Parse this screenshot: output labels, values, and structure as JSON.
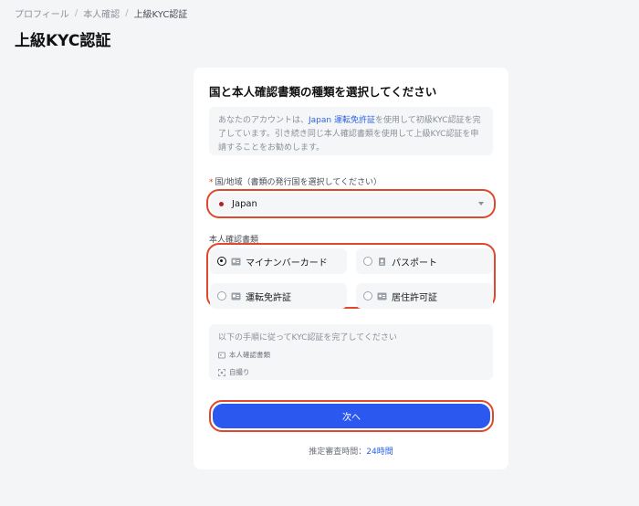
{
  "breadcrumb": {
    "items": [
      "プロフィール",
      "本人確認",
      "上級KYC認証"
    ],
    "separator": "/"
  },
  "page_title": "上級KYC認証",
  "card": {
    "title": "国と本人確認書類の種類を選択してください",
    "info": {
      "prefix": "あなたのアカウントは、",
      "link": "Japan 運転免許証",
      "suffix": "を使用して初級KYC認証を完了しています。引き続き同じ本人確認書類を使用して上級KYC認証を申請することをお勧めします。"
    },
    "country_field": {
      "required_mark": "*",
      "label": "国/地域（書類の発行国を選択してください）",
      "value": "Japan"
    },
    "doc_type": {
      "label": "本人確認書類",
      "options": [
        {
          "label": "マイナンバーカード",
          "selected": true
        },
        {
          "label": "パスポート",
          "selected": false
        },
        {
          "label": "運転免許証",
          "selected": false
        },
        {
          "label": "居住許可証",
          "selected": false
        }
      ]
    },
    "steps": {
      "intro": "以下の手順に従ってKYC認証を完了してください",
      "items": [
        "本人確認書類",
        "自撮り"
      ]
    },
    "next_label": "次へ",
    "eta": {
      "label": "推定審査時間：",
      "value": "24時間"
    }
  },
  "colors": {
    "accent": "#2b59f0",
    "highlight_border": "#e0482e",
    "link": "#2c63e6"
  }
}
